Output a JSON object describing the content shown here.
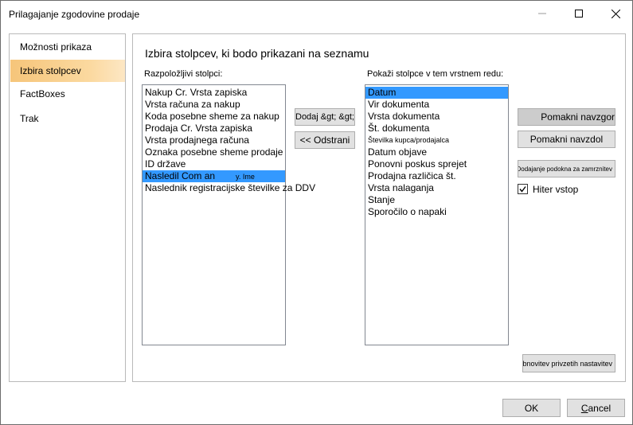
{
  "window": {
    "title": "Prilagajanje zgodovine prodaje"
  },
  "nav": {
    "items": [
      {
        "label": "Možnosti prikaza"
      },
      {
        "label": "Izbira stolpcev"
      },
      {
        "label": "FactBoxes"
      },
      {
        "label": "Trak"
      }
    ]
  },
  "main": {
    "heading": "Izbira stolpcev, ki bodo prikazani na seznamu",
    "available_label": "Razpoložljivi stolpci:",
    "shown_label": "Pokaži stolpce v tem vrstnem redu:",
    "available_items": [
      "Nakup Cr. Vrsta zapiska",
      "Vrsta računa za nakup",
      "Koda posebne sheme za nakup",
      "Prodaja Cr. Vrsta zapiska",
      "Vrsta prodajnega računa",
      "Oznaka posebne sheme prodaje",
      "ID države",
      "Nasledil Com an",
      "Naslednik registracijske številke za DDV"
    ],
    "available_selected_suffix": "y. Ime",
    "shown_items": [
      "Datum",
      "Vir dokumenta",
      "Vrsta dokumenta",
      "Št. dokumenta",
      "Številka kupca/prodajalca",
      "Datum objave",
      "Ponovni poskus sprejet",
      "Prodajna različica št.",
      "Vrsta nalaganja",
      "Stanje",
      "Sporočilo o napaki"
    ],
    "add_button": "Dodaj &gt; &gt;",
    "remove_button": "<< Odstrani",
    "move_up_button": "Pomakni navzgor",
    "move_down_button": "Pomakni navzdol",
    "freeze_button": "Dodajanje podokna za zamrznitev",
    "quick_entry_label": "Hiter vstop",
    "quick_entry_checked": true,
    "restore_button": "Obnovitev privzetih nastavitev"
  },
  "footer": {
    "ok": "OK",
    "cancel_first": "C",
    "cancel_rest": "ancel"
  },
  "colors": {
    "selection": "#3399ff",
    "nav_selected": "#f6c57a",
    "button_face": "#e1e1e1"
  }
}
